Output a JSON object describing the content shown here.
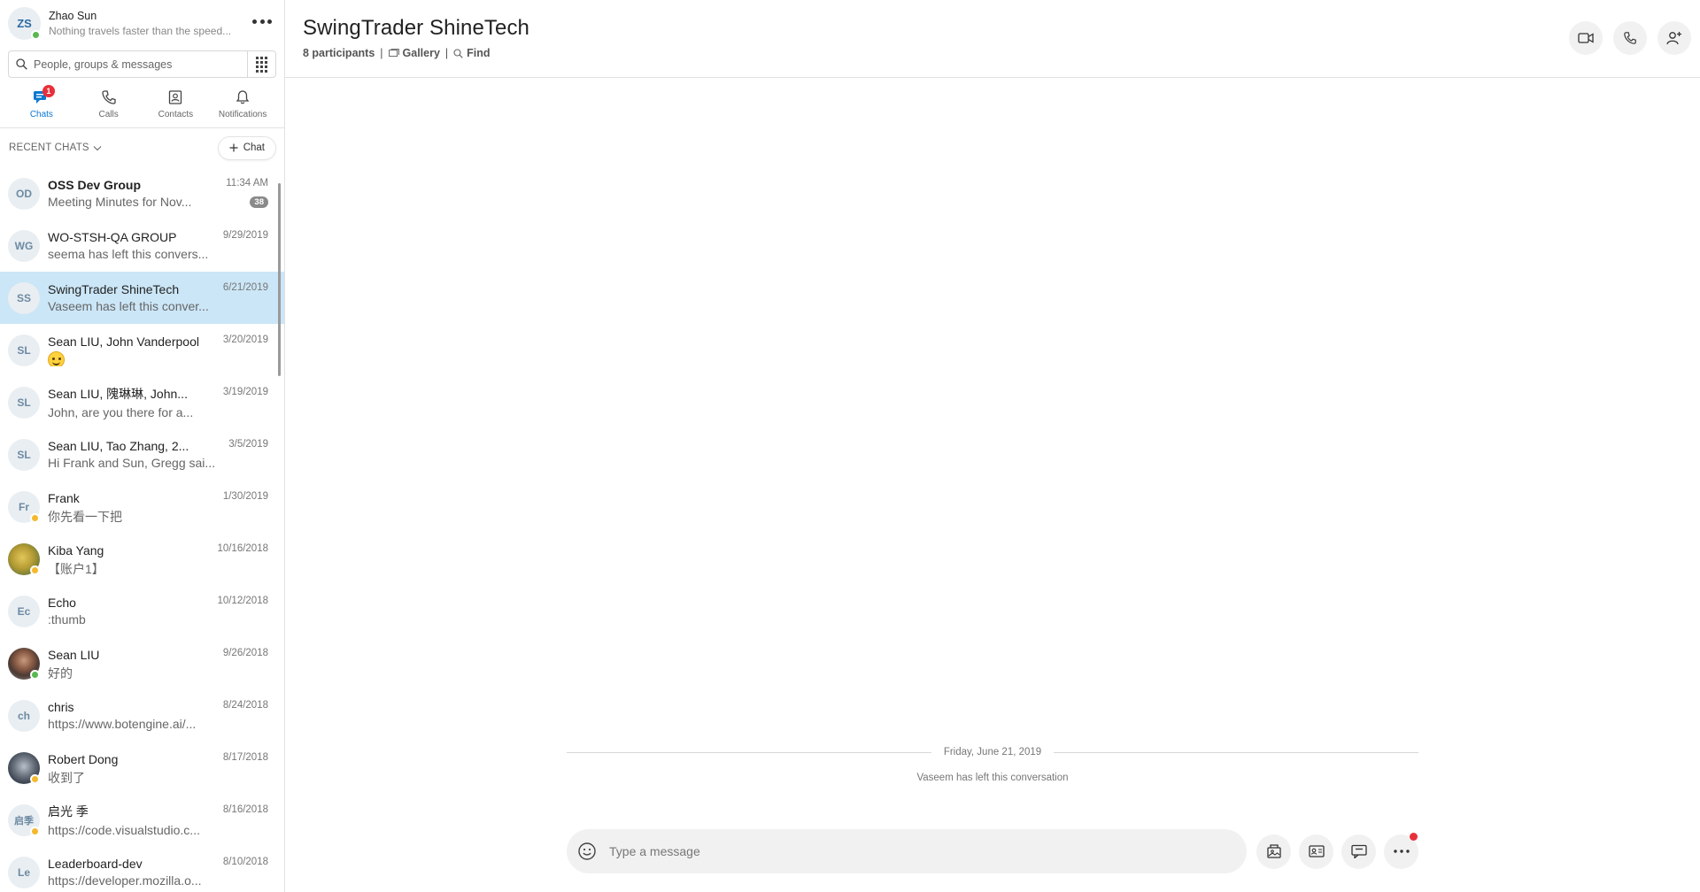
{
  "profile": {
    "initials": "ZS",
    "name": "Zhao Sun",
    "mood": "Nothing travels faster than the speed..."
  },
  "search": {
    "placeholder": "People, groups & messages"
  },
  "nav_tabs": [
    {
      "label": "Chats",
      "badge": "1"
    },
    {
      "label": "Calls"
    },
    {
      "label": "Contacts"
    },
    {
      "label": "Notifications"
    }
  ],
  "recent": {
    "title": "RECENT CHATS",
    "new_chat_label": "Chat"
  },
  "chats": [
    {
      "initials": "OD",
      "name": "OSS Dev Group",
      "preview": "Meeting Minutes for Nov...",
      "date": "11:34 AM",
      "unread": "38"
    },
    {
      "initials": "WG",
      "name": "WO-STSH-QA GROUP",
      "preview": "seema has left this convers...",
      "date": "9/29/2019"
    },
    {
      "initials": "SS",
      "name": "SwingTrader ShineTech",
      "preview": "Vaseem has left this conver...",
      "date": "6/21/2019"
    },
    {
      "initials": "SL",
      "name": "Sean LIU, John Vanderpool",
      "preview": "",
      "date": "3/20/2019"
    },
    {
      "initials": "SL",
      "name": "Sean LIU, 隗琳琳, John...",
      "preview": "John, are you there for a...",
      "date": "3/19/2019"
    },
    {
      "initials": "SL",
      "name": "Sean LIU, Tao Zhang, 2...",
      "preview": "Hi Frank and Sun, Gregg sai...",
      "date": "3/5/2019"
    },
    {
      "initials": "Fr",
      "name": "Frank",
      "preview": "你先看一下把",
      "date": "1/30/2019"
    },
    {
      "initials": "",
      "name": "Kiba Yang",
      "preview": "【账户1】",
      "date": "10/16/2018"
    },
    {
      "initials": "Ec",
      "name": "Echo",
      "preview": ":thumb",
      "date": "10/12/2018"
    },
    {
      "initials": "",
      "name": "Sean LIU",
      "preview": "好的",
      "date": "9/26/2018"
    },
    {
      "initials": "ch",
      "name": "chris",
      "preview": "https://www.botengine.ai/...",
      "date": "8/24/2018"
    },
    {
      "initials": "",
      "name": "Robert Dong",
      "preview": "收到了",
      "date": "8/17/2018"
    },
    {
      "initials": "启季",
      "name": "启光 季",
      "preview": "https://code.visualstudio.c...",
      "date": "8/16/2018"
    },
    {
      "initials": "Le",
      "name": "Leaderboard-dev",
      "preview": "https://developer.mozilla.o...",
      "date": "8/10/2018"
    }
  ],
  "conversation": {
    "title": "SwingTrader ShineTech",
    "participants": "8 participants",
    "gallery_label": "Gallery",
    "find_label": "Find",
    "date_divider": "Friday, June 21, 2019",
    "system_message": "Vaseem has left this conversation"
  },
  "composer": {
    "placeholder": "Type a message"
  },
  "colors": {
    "accent": "#0b78d0",
    "selected": "#cbe6f7",
    "badge": "#e8303a",
    "online": "#59b851",
    "away": "#f5b82e"
  }
}
